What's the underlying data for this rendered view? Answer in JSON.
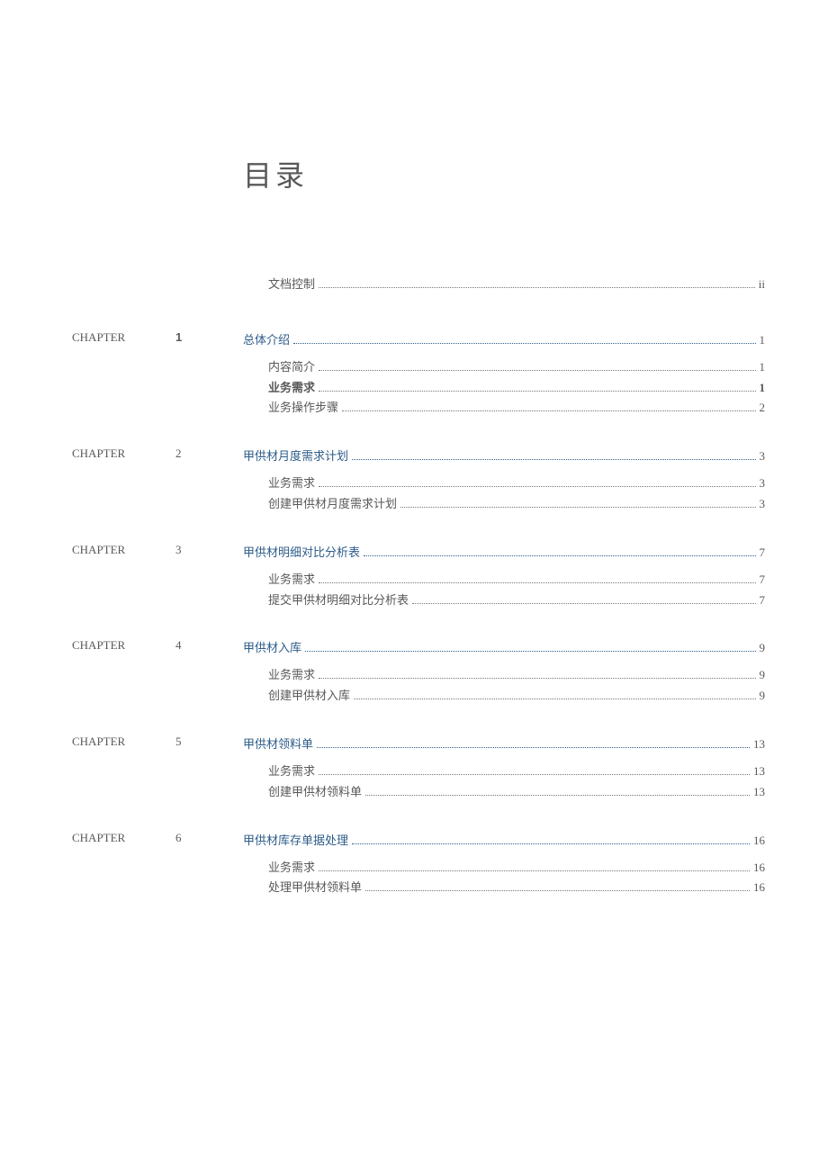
{
  "title": "目录",
  "preamble": {
    "label": "文档控制",
    "page": "ii"
  },
  "chapter_label": "CHAPTER",
  "chapters": [
    {
      "num": "1",
      "num_bold": true,
      "title": "总体介绍",
      "page": "1",
      "page_bold": false,
      "subs": [
        {
          "label": "内容简介",
          "page": "1",
          "bold": false
        },
        {
          "label": "业务需求",
          "page": "1",
          "bold": true
        },
        {
          "label": "业务操作步骤",
          "page": "2",
          "bold": false
        }
      ]
    },
    {
      "num": "2",
      "num_bold": false,
      "title": "甲供材月度需求计划",
      "page": "3",
      "page_bold": false,
      "subs": [
        {
          "label": "业务需求",
          "page": "3",
          "bold": false
        },
        {
          "label": "创建甲供材月度需求计划",
          "page": "3",
          "bold": false
        }
      ]
    },
    {
      "num": "3",
      "num_bold": false,
      "title": "甲供材明细对比分析表",
      "page": "7",
      "page_bold": false,
      "subs": [
        {
          "label": "业务需求",
          "page": "7",
          "bold": false
        },
        {
          "label": "提交甲供材明细对比分析表",
          "page": "7",
          "bold": false
        }
      ]
    },
    {
      "num": "4",
      "num_bold": false,
      "title": "甲供材入库",
      "page": "9",
      "page_bold": false,
      "subs": [
        {
          "label": "业务需求",
          "page": "9",
          "bold": false
        },
        {
          "label": "创建甲供材入库",
          "page": "9",
          "bold": false
        }
      ]
    },
    {
      "num": "5",
      "num_bold": false,
      "title": "甲供材领料单",
      "page": "13",
      "page_bold": false,
      "subs": [
        {
          "label": "业务需求",
          "page": "13",
          "bold": false
        },
        {
          "label": "创建甲供材领料单",
          "page": "13",
          "bold": false
        }
      ]
    },
    {
      "num": "6",
      "num_bold": false,
      "title": "甲供材库存单据处理",
      "page": "16",
      "page_bold": false,
      "subs": [
        {
          "label": "业务需求",
          "page": "16",
          "bold": false
        },
        {
          "label": "处理甲供材领料单",
          "page": "16",
          "bold": false
        }
      ]
    }
  ]
}
